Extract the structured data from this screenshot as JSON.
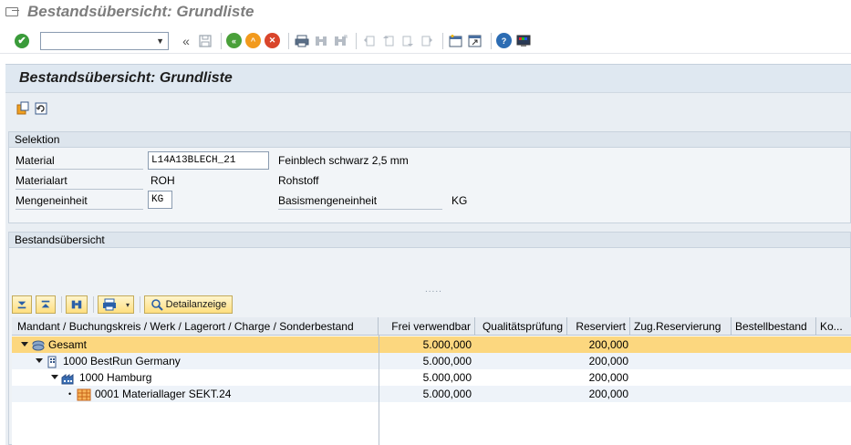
{
  "window": {
    "title": "Bestandsübersicht: Grundliste"
  },
  "systoolbar": {
    "command_value": "",
    "back_glyph": "«"
  },
  "app": {
    "title": "Bestandsübersicht: Grundliste"
  },
  "selection": {
    "heading": "Selektion",
    "material_label": "Material",
    "material_value": "L14A13BLECH_21",
    "material_text": "Feinblech schwarz 2,5 mm",
    "materialart_label": "Materialart",
    "materialart_value": "ROH",
    "materialart_text": "Rohstoff",
    "unit_label": "Mengeneinheit",
    "unit_value": "KG",
    "base_unit_label": "Basismengeneinheit",
    "base_unit_value": "KG"
  },
  "overview": {
    "heading": "Bestandsübersicht",
    "splitter_dots": "....."
  },
  "alv_toolbar": {
    "detail_label": "Detailanzeige"
  },
  "table": {
    "columns": [
      "Mandant / Buchungskreis / Werk / Lagerort / Charge / Sonderbestand",
      "Frei verwendbar",
      "Qualitätsprüfung",
      "Reserviert",
      "Zug.Reservierung",
      "Bestellbestand",
      "Ko..."
    ],
    "rows": [
      {
        "label": "Gesamt",
        "frei": "5.000,000",
        "reserviert": "200,000",
        "level": 0
      },
      {
        "label": "1000 BestRun Germany",
        "frei": "5.000,000",
        "reserviert": "200,000",
        "level": 1
      },
      {
        "label": "1000 Hamburg",
        "frei": "5.000,000",
        "reserviert": "200,000",
        "level": 2
      },
      {
        "label": "0001 Materiallager SEKT.24",
        "frei": "5.000,000",
        "reserviert": "200,000",
        "level": 3
      }
    ]
  },
  "colors": {
    "selected_row": "#fcd77f",
    "header_bg": "#dfe8f1",
    "ok_green": "#3a9b3a"
  }
}
